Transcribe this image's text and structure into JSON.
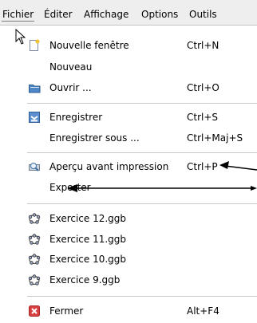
{
  "menubar": {
    "items": [
      {
        "label": "Fichier"
      },
      {
        "label": "Éditer"
      },
      {
        "label": "Affichage"
      },
      {
        "label": "Options"
      },
      {
        "label": "Outils"
      }
    ]
  },
  "menu": {
    "items": [
      {
        "label": "Nouvelle fenêtre",
        "shortcut": "Ctrl+N",
        "icon": "new-window-icon"
      },
      {
        "label": "Nouveau",
        "shortcut": "",
        "icon": ""
      },
      {
        "label": "Ouvrir ...",
        "shortcut": "Ctrl+O",
        "icon": "folder-icon"
      },
      {
        "label": "Enregistrer",
        "shortcut": "Ctrl+S",
        "icon": "save-icon"
      },
      {
        "label": "Enregistrer sous ...",
        "shortcut": "Ctrl+Maj+S",
        "icon": ""
      },
      {
        "label": "Aperçu avant impression",
        "shortcut": "Ctrl+P",
        "icon": "print-preview-icon"
      },
      {
        "label": "Exporter",
        "shortcut": "",
        "icon": ""
      },
      {
        "label": "Exercice 12.ggb",
        "shortcut": "",
        "icon": "geogebra-file-icon"
      },
      {
        "label": "Exercice 11.ggb",
        "shortcut": "",
        "icon": "geogebra-file-icon"
      },
      {
        "label": "Exercice 10.ggb",
        "shortcut": "",
        "icon": "geogebra-file-icon"
      },
      {
        "label": "Exercice 9.ggb",
        "shortcut": "",
        "icon": "geogebra-file-icon"
      },
      {
        "label": "Fermer",
        "shortcut": "Alt+F4",
        "icon": "close-icon"
      }
    ]
  },
  "colors": {
    "menubar_bg": "#eeeeee",
    "menu_bg": "#ffffff",
    "separator": "#c8c8c8",
    "close_icon": "#d94040",
    "folder_icon": "#4f86c6",
    "geogebra_icon": "#6c6c8c"
  }
}
